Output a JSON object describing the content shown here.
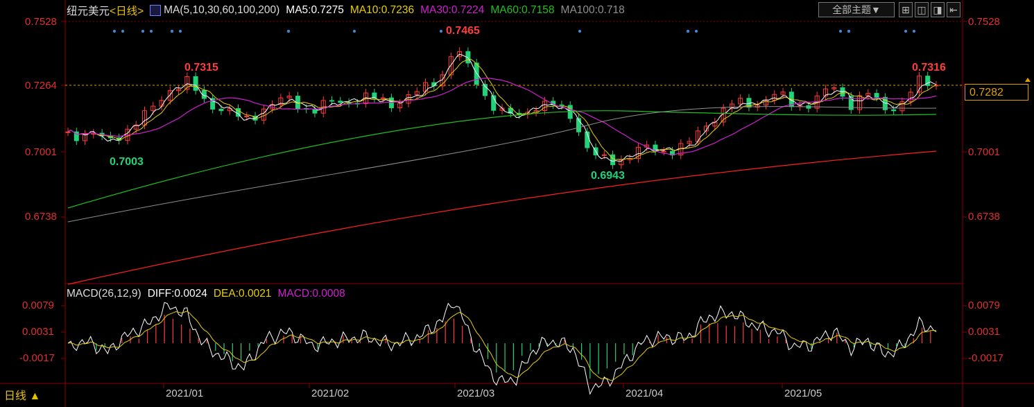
{
  "header": {
    "symbol": "纽元美元",
    "period": "<日线>",
    "ma_def": "MA(5,10,30,60,100,200)",
    "ma5": "MA5:0.7275",
    "ma10": "MA10:0.7236",
    "ma30": "MA30:0.7224",
    "ma60": "MA60:0.7158",
    "ma100": "MA100:0.718"
  },
  "toolbar": {
    "theme_select": "全部主题▼",
    "buttons": [
      "⊞",
      "◫",
      "◨",
      "⇤"
    ]
  },
  "price_axis": {
    "left": [
      "0.7528",
      "0.7264",
      "0.7001",
      "0.6738"
    ],
    "right": [
      "0.7528",
      "0.7001",
      "0.6738"
    ],
    "current_price": "0.7282"
  },
  "annotations": {
    "high1": "0.7315",
    "low1": "0.7003",
    "high2": "0.7465",
    "low2": "0.6943",
    "high3": "0.7316"
  },
  "macd": {
    "label": "MACD(26,12,9)",
    "diff": "DIFF:0.0024",
    "dea": "DEA:0.0021",
    "macd": "MACD:0.0008",
    "axis": [
      "0.0079",
      "0.0031",
      "-0.0017"
    ]
  },
  "xaxis": [
    "2021/01",
    "2021/02",
    "2021/03",
    "2021/04",
    "2021/05"
  ],
  "period_button": "日线 ▲",
  "colors": {
    "up": "#ff3c3c",
    "down": "#22d37a",
    "ma5": "#ffffff",
    "ma10": "#e8d000",
    "ma30": "#d020d0",
    "ma60": "#20c020",
    "ma100": "#909090",
    "ma200": "#ff2020",
    "grid": "#8b0000"
  },
  "chart_data": {
    "type": "candlestick",
    "series": [
      {
        "name": "MA5",
        "value": 0.7275
      },
      {
        "name": "MA10",
        "value": 0.7236
      },
      {
        "name": "MA30",
        "value": 0.7224
      },
      {
        "name": "MA60",
        "value": 0.7158
      },
      {
        "name": "MA100",
        "value": 0.718
      }
    ],
    "ylim": [
      0.6738,
      0.7528
    ],
    "current": 0.7282,
    "extremes": [
      0.7315,
      0.7003,
      0.7465,
      0.6943,
      0.7316
    ]
  }
}
